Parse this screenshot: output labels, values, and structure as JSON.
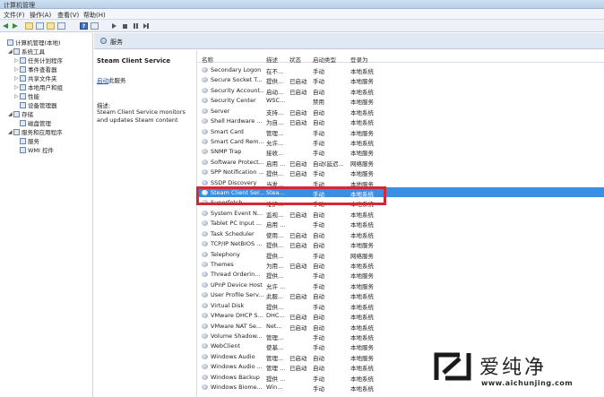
{
  "window": {
    "title": "计算机管理"
  },
  "menu": [
    "文件(F)",
    "操作(A)",
    "查看(V)",
    "帮助(H)"
  ],
  "tree": [
    {
      "label": "计算机管理(本地)",
      "level": 0,
      "expand": ""
    },
    {
      "label": "系统工具",
      "level": 1,
      "expand": "◢"
    },
    {
      "label": "任务计划程序",
      "level": 2,
      "expand": "▷"
    },
    {
      "label": "事件查看器",
      "level": 2,
      "expand": "▷"
    },
    {
      "label": "共享文件夹",
      "level": 2,
      "expand": "▷"
    },
    {
      "label": "本地用户和组",
      "level": 2,
      "expand": "▷"
    },
    {
      "label": "性能",
      "level": 2,
      "expand": "▷"
    },
    {
      "label": "设备管理器",
      "level": 2,
      "expand": ""
    },
    {
      "label": "存储",
      "level": 1,
      "expand": "◢"
    },
    {
      "label": "磁盘管理",
      "level": 2,
      "expand": ""
    },
    {
      "label": "服务和应用程序",
      "level": 1,
      "expand": "◢"
    },
    {
      "label": "服务",
      "level": 2,
      "expand": ""
    },
    {
      "label": "WMI 控件",
      "level": 2,
      "expand": ""
    }
  ],
  "header": {
    "title": "服务"
  },
  "detail": {
    "service_name": "Steam Client Service",
    "action_link": "启动",
    "action_suffix": "此服务",
    "desc_label": "描述:",
    "desc_text": "Steam Client Service monitors and updates Steam content"
  },
  "columns": {
    "name": "名称",
    "desc": "描述",
    "status": "状态",
    "startup": "启动类型",
    "logon": "登录为"
  },
  "services": [
    {
      "name": "Secondary Logon",
      "desc": "在不...",
      "status": "",
      "startup": "手动",
      "logon": "本地系统"
    },
    {
      "name": "Secure Socket T...",
      "desc": "提供...",
      "status": "已启动",
      "startup": "手动",
      "logon": "本地服务"
    },
    {
      "name": "Security Account...",
      "desc": "启动...",
      "status": "已启动",
      "startup": "自动",
      "logon": "本地系统"
    },
    {
      "name": "Security Center",
      "desc": "WSC...",
      "status": "",
      "startup": "禁用",
      "logon": "本地服务"
    },
    {
      "name": "Server",
      "desc": "支持...",
      "status": "已启动",
      "startup": "自动",
      "logon": "本地系统"
    },
    {
      "name": "Shell Hardware ...",
      "desc": "为自...",
      "status": "已启动",
      "startup": "自动",
      "logon": "本地系统"
    },
    {
      "name": "Smart Card",
      "desc": "管理...",
      "status": "",
      "startup": "手动",
      "logon": "本地服务"
    },
    {
      "name": "Smart Card Rem...",
      "desc": "允许...",
      "status": "",
      "startup": "手动",
      "logon": "本地系统"
    },
    {
      "name": "SNMP Trap",
      "desc": "接收...",
      "status": "",
      "startup": "手动",
      "logon": "本地服务"
    },
    {
      "name": "Software Protect...",
      "desc": "启用 ...",
      "status": "已启动",
      "startup": "自动(延迟...",
      "logon": "网络服务"
    },
    {
      "name": "SPP Notification ...",
      "desc": "提供...",
      "status": "已启动",
      "startup": "手动",
      "logon": "本地服务"
    },
    {
      "name": "SSDP Discovery",
      "desc": "当发...",
      "status": "",
      "startup": "手动",
      "logon": "本地服务"
    },
    {
      "name": "Steam Client Ser...",
      "desc": "Stea...",
      "status": "",
      "startup": "手动",
      "logon": "本地系统",
      "selected": true
    },
    {
      "name": "Superfetch",
      "desc": "维护...",
      "status": "",
      "startup": "手动",
      "logon": "本地系统"
    },
    {
      "name": "System Event N...",
      "desc": "监视...",
      "status": "已启动",
      "startup": "自动",
      "logon": "本地系统"
    },
    {
      "name": "Tablet PC Input ...",
      "desc": "启用 ...",
      "status": "",
      "startup": "手动",
      "logon": "本地系统"
    },
    {
      "name": "Task Scheduler",
      "desc": "使用...",
      "status": "已启动",
      "startup": "自动",
      "logon": "本地系统"
    },
    {
      "name": "TCP/IP NetBIOS ...",
      "desc": "提供...",
      "status": "已启动",
      "startup": "自动",
      "logon": "本地服务"
    },
    {
      "name": "Telephony",
      "desc": "提供...",
      "status": "",
      "startup": "手动",
      "logon": "网络服务"
    },
    {
      "name": "Themes",
      "desc": "为用...",
      "status": "已启动",
      "startup": "自动",
      "logon": "本地系统"
    },
    {
      "name": "Thread Orderin...",
      "desc": "提供...",
      "status": "",
      "startup": "手动",
      "logon": "本地服务"
    },
    {
      "name": "UPnP Device Host",
      "desc": "允许 ...",
      "status": "",
      "startup": "手动",
      "logon": "本地服务"
    },
    {
      "name": "User Profile Serv...",
      "desc": "此服...",
      "status": "已启动",
      "startup": "自动",
      "logon": "本地系统"
    },
    {
      "name": "Virtual Disk",
      "desc": "提供...",
      "status": "",
      "startup": "手动",
      "logon": "本地系统"
    },
    {
      "name": "VMware DHCP S...",
      "desc": "DHC...",
      "status": "已启动",
      "startup": "自动",
      "logon": "本地系统"
    },
    {
      "name": "VMware NAT Se...",
      "desc": "Net...",
      "status": "已启动",
      "startup": "自动",
      "logon": "本地系统"
    },
    {
      "name": "Volume Shadow...",
      "desc": "管理...",
      "status": "",
      "startup": "手动",
      "logon": "本地系统"
    },
    {
      "name": "WebClient",
      "desc": "使基...",
      "status": "",
      "startup": "手动",
      "logon": "本地服务"
    },
    {
      "name": "Windows Audio",
      "desc": "管理...",
      "status": "已启动",
      "startup": "自动",
      "logon": "本地服务"
    },
    {
      "name": "Windows Audio ...",
      "desc": "管理 ...",
      "status": "已启动",
      "startup": "自动",
      "logon": "本地系统"
    },
    {
      "name": "Windows Backup",
      "desc": "提供 ...",
      "status": "",
      "startup": "手动",
      "logon": "本地系统"
    },
    {
      "name": "Windows Biome...",
      "desc": "Win...",
      "status": "",
      "startup": "手动",
      "logon": "本地系统"
    }
  ],
  "watermark": {
    "brand": "爱纯净",
    "url": "www.aichunjing.com",
    "color": "#1a1a1a",
    "accent": "#d3283a"
  }
}
